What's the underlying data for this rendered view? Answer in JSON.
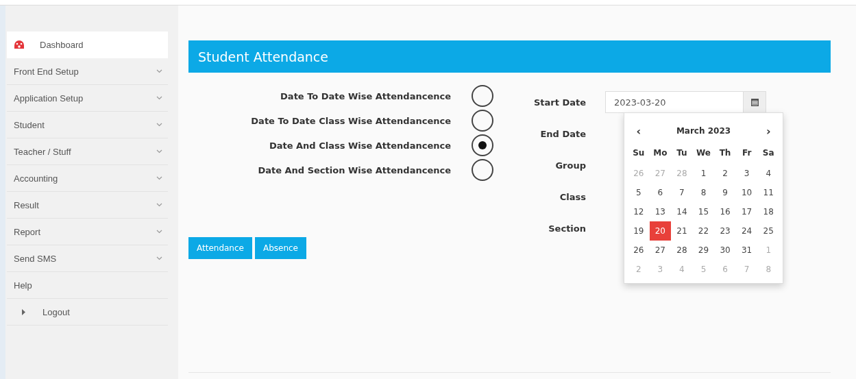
{
  "sidebar": {
    "items": [
      {
        "label": "Dashboard",
        "kind": "icon",
        "selected": true
      },
      {
        "label": "Front End Setup",
        "kind": "menu",
        "selected": false
      },
      {
        "label": "Application Setup",
        "kind": "menu",
        "selected": false
      },
      {
        "label": "Student",
        "kind": "menu",
        "selected": false
      },
      {
        "label": "Teacher / Stuff",
        "kind": "menu",
        "selected": false
      },
      {
        "label": "Accounting",
        "kind": "menu",
        "selected": false
      },
      {
        "label": "Result",
        "kind": "menu",
        "selected": false
      },
      {
        "label": "Report",
        "kind": "menu",
        "selected": false
      },
      {
        "label": "Send SMS",
        "kind": "menu",
        "selected": false
      },
      {
        "label": "Help",
        "kind": "plain",
        "selected": false
      },
      {
        "label": "Logout",
        "kind": "arrow",
        "selected": false
      }
    ]
  },
  "panel": {
    "title": "Student Attendance",
    "report_types": [
      {
        "label": "Date To Date Wise Attendancence",
        "selected": false
      },
      {
        "label": "Date To Date Class Wise Attendancence",
        "selected": false
      },
      {
        "label": "Date And Class Wise Attendancence",
        "selected": true
      },
      {
        "label": "Date And Section Wise Attendancence",
        "selected": false
      }
    ],
    "fields": [
      {
        "label": "Start Date",
        "value": "2023-03-20"
      },
      {
        "label": "End Date"
      },
      {
        "label": "Group"
      },
      {
        "label": "Class"
      },
      {
        "label": "Section"
      }
    ],
    "buttons": [
      "Attendance",
      "Absence"
    ]
  },
  "datepicker": {
    "prev": "‹",
    "month": "March 2023",
    "next": "›",
    "weekdays": [
      "Su",
      "Mo",
      "Tu",
      "We",
      "Th",
      "Fr",
      "Sa"
    ],
    "weeks": [
      [
        {
          "day": "26",
          "muted": true,
          "selected": false
        },
        {
          "day": "27",
          "muted": true,
          "selected": false
        },
        {
          "day": "28",
          "muted": true,
          "selected": false
        },
        {
          "day": "1",
          "muted": false,
          "selected": false
        },
        {
          "day": "2",
          "muted": false,
          "selected": false
        },
        {
          "day": "3",
          "muted": false,
          "selected": false
        },
        {
          "day": "4",
          "muted": false,
          "selected": false
        }
      ],
      [
        {
          "day": "5",
          "muted": false,
          "selected": false
        },
        {
          "day": "6",
          "muted": false,
          "selected": false
        },
        {
          "day": "7",
          "muted": false,
          "selected": false
        },
        {
          "day": "8",
          "muted": false,
          "selected": false
        },
        {
          "day": "9",
          "muted": false,
          "selected": false
        },
        {
          "day": "10",
          "muted": false,
          "selected": false
        },
        {
          "day": "11",
          "muted": false,
          "selected": false
        }
      ],
      [
        {
          "day": "12",
          "muted": false,
          "selected": false
        },
        {
          "day": "13",
          "muted": false,
          "selected": false
        },
        {
          "day": "14",
          "muted": false,
          "selected": false
        },
        {
          "day": "15",
          "muted": false,
          "selected": false
        },
        {
          "day": "16",
          "muted": false,
          "selected": false
        },
        {
          "day": "17",
          "muted": false,
          "selected": false
        },
        {
          "day": "18",
          "muted": false,
          "selected": false
        }
      ],
      [
        {
          "day": "19",
          "muted": false,
          "selected": false
        },
        {
          "day": "20",
          "muted": false,
          "selected": true
        },
        {
          "day": "21",
          "muted": false,
          "selected": false
        },
        {
          "day": "22",
          "muted": false,
          "selected": false
        },
        {
          "day": "23",
          "muted": false,
          "selected": false
        },
        {
          "day": "24",
          "muted": false,
          "selected": false
        },
        {
          "day": "25",
          "muted": false,
          "selected": false
        }
      ],
      [
        {
          "day": "26",
          "muted": false,
          "selected": false
        },
        {
          "day": "27",
          "muted": false,
          "selected": false
        },
        {
          "day": "28",
          "muted": false,
          "selected": false
        },
        {
          "day": "29",
          "muted": false,
          "selected": false
        },
        {
          "day": "30",
          "muted": false,
          "selected": false
        },
        {
          "day": "31",
          "muted": false,
          "selected": false
        },
        {
          "day": "1",
          "muted": true,
          "selected": false
        }
      ],
      [
        {
          "day": "2",
          "muted": true,
          "selected": false
        },
        {
          "day": "3",
          "muted": true,
          "selected": false
        },
        {
          "day": "4",
          "muted": true,
          "selected": false
        },
        {
          "day": "5",
          "muted": true,
          "selected": false
        },
        {
          "day": "6",
          "muted": true,
          "selected": false
        },
        {
          "day": "7",
          "muted": true,
          "selected": false
        },
        {
          "day": "8",
          "muted": true,
          "selected": false
        }
      ]
    ]
  }
}
